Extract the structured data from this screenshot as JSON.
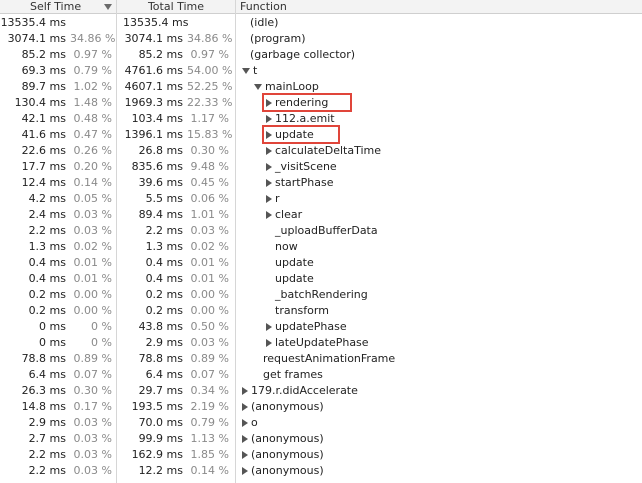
{
  "columns": {
    "self_time": "Self Time",
    "total_time": "Total Time",
    "function": "Function"
  },
  "rows": [
    {
      "self_ms": "13535.4 ms",
      "self_pct": "",
      "total_ms": "13535.4 ms",
      "total_pct": "",
      "name": "(idle)",
      "depth": 0,
      "toggle": "none"
    },
    {
      "self_ms": "3074.1 ms",
      "self_pct": "34.86 %",
      "total_ms": "3074.1 ms",
      "total_pct": "34.86 %",
      "name": "(program)",
      "depth": 0,
      "toggle": "none"
    },
    {
      "self_ms": "85.2 ms",
      "self_pct": "0.97 %",
      "total_ms": "85.2 ms",
      "total_pct": "0.97 %",
      "name": "(garbage collector)",
      "depth": 0,
      "toggle": "none"
    },
    {
      "self_ms": "69.3 ms",
      "self_pct": "0.79 %",
      "total_ms": "4761.6 ms",
      "total_pct": "54.00 %",
      "name": "t",
      "depth": 0,
      "toggle": "expanded"
    },
    {
      "self_ms": "89.7 ms",
      "self_pct": "1.02 %",
      "total_ms": "4607.1 ms",
      "total_pct": "52.25 %",
      "name": "mainLoop",
      "depth": 1,
      "toggle": "expanded"
    },
    {
      "self_ms": "130.4 ms",
      "self_pct": "1.48 %",
      "total_ms": "1969.3 ms",
      "total_pct": "22.33 %",
      "name": "rendering",
      "depth": 2,
      "toggle": "collapsed"
    },
    {
      "self_ms": "42.1 ms",
      "self_pct": "0.48 %",
      "total_ms": "103.4 ms",
      "total_pct": "1.17 %",
      "name": "112.a.emit",
      "depth": 2,
      "toggle": "collapsed"
    },
    {
      "self_ms": "41.6 ms",
      "self_pct": "0.47 %",
      "total_ms": "1396.1 ms",
      "total_pct": "15.83 %",
      "name": "update",
      "depth": 2,
      "toggle": "collapsed"
    },
    {
      "self_ms": "22.6 ms",
      "self_pct": "0.26 %",
      "total_ms": "26.8 ms",
      "total_pct": "0.30 %",
      "name": "calculateDeltaTime",
      "depth": 2,
      "toggle": "collapsed"
    },
    {
      "self_ms": "17.7 ms",
      "self_pct": "0.20 %",
      "total_ms": "835.6 ms",
      "total_pct": "9.48 %",
      "name": "_visitScene",
      "depth": 2,
      "toggle": "collapsed"
    },
    {
      "self_ms": "12.4 ms",
      "self_pct": "0.14 %",
      "total_ms": "39.6 ms",
      "total_pct": "0.45 %",
      "name": "startPhase",
      "depth": 2,
      "toggle": "collapsed"
    },
    {
      "self_ms": "4.2 ms",
      "self_pct": "0.05 %",
      "total_ms": "5.5 ms",
      "total_pct": "0.06 %",
      "name": "r",
      "depth": 2,
      "toggle": "collapsed"
    },
    {
      "self_ms": "2.4 ms",
      "self_pct": "0.03 %",
      "total_ms": "89.4 ms",
      "total_pct": "1.01 %",
      "name": "clear",
      "depth": 2,
      "toggle": "collapsed"
    },
    {
      "self_ms": "2.2 ms",
      "self_pct": "0.03 %",
      "total_ms": "2.2 ms",
      "total_pct": "0.03 %",
      "name": "_uploadBufferData",
      "depth": 2,
      "toggle": "none"
    },
    {
      "self_ms": "1.3 ms",
      "self_pct": "0.02 %",
      "total_ms": "1.3 ms",
      "total_pct": "0.02 %",
      "name": "now",
      "depth": 2,
      "toggle": "none"
    },
    {
      "self_ms": "0.4 ms",
      "self_pct": "0.01 %",
      "total_ms": "0.4 ms",
      "total_pct": "0.01 %",
      "name": "update",
      "depth": 2,
      "toggle": "none"
    },
    {
      "self_ms": "0.4 ms",
      "self_pct": "0.01 %",
      "total_ms": "0.4 ms",
      "total_pct": "0.01 %",
      "name": "update",
      "depth": 2,
      "toggle": "none"
    },
    {
      "self_ms": "0.2 ms",
      "self_pct": "0.00 %",
      "total_ms": "0.2 ms",
      "total_pct": "0.00 %",
      "name": "_batchRendering",
      "depth": 2,
      "toggle": "none"
    },
    {
      "self_ms": "0.2 ms",
      "self_pct": "0.00 %",
      "total_ms": "0.2 ms",
      "total_pct": "0.00 %",
      "name": "transform",
      "depth": 2,
      "toggle": "none"
    },
    {
      "self_ms": "0 ms",
      "self_pct": "0 %",
      "total_ms": "43.8 ms",
      "total_pct": "0.50 %",
      "name": "updatePhase",
      "depth": 2,
      "toggle": "collapsed"
    },
    {
      "self_ms": "0 ms",
      "self_pct": "0 %",
      "total_ms": "2.9 ms",
      "total_pct": "0.03 %",
      "name": "lateUpdatePhase",
      "depth": 2,
      "toggle": "collapsed"
    },
    {
      "self_ms": "78.8 ms",
      "self_pct": "0.89 %",
      "total_ms": "78.8 ms",
      "total_pct": "0.89 %",
      "name": "requestAnimationFrame",
      "depth": 1,
      "toggle": "none"
    },
    {
      "self_ms": "6.4 ms",
      "self_pct": "0.07 %",
      "total_ms": "6.4 ms",
      "total_pct": "0.07 %",
      "name": "get frames",
      "depth": 1,
      "toggle": "none"
    },
    {
      "self_ms": "26.3 ms",
      "self_pct": "0.30 %",
      "total_ms": "29.7 ms",
      "total_pct": "0.34 %",
      "name": "179.r.didAccelerate",
      "depth": 0,
      "toggle": "collapsed"
    },
    {
      "self_ms": "14.8 ms",
      "self_pct": "0.17 %",
      "total_ms": "193.5 ms",
      "total_pct": "2.19 %",
      "name": "(anonymous)",
      "depth": 0,
      "toggle": "collapsed"
    },
    {
      "self_ms": "2.9 ms",
      "self_pct": "0.03 %",
      "total_ms": "70.0 ms",
      "total_pct": "0.79 %",
      "name": "o",
      "depth": 0,
      "toggle": "collapsed"
    },
    {
      "self_ms": "2.7 ms",
      "self_pct": "0.03 %",
      "total_ms": "99.9 ms",
      "total_pct": "1.13 %",
      "name": "(anonymous)",
      "depth": 0,
      "toggle": "collapsed"
    },
    {
      "self_ms": "2.2 ms",
      "self_pct": "0.03 %",
      "total_ms": "162.9 ms",
      "total_pct": "1.85 %",
      "name": "(anonymous)",
      "depth": 0,
      "toggle": "collapsed"
    },
    {
      "self_ms": "2.2 ms",
      "self_pct": "0.03 %",
      "total_ms": "12.2 ms",
      "total_pct": "0.14 %",
      "name": "(anonymous)",
      "depth": 0,
      "toggle": "collapsed"
    }
  ],
  "highlighted_rows": [
    5,
    7
  ],
  "colors": {
    "highlight": "#e0453a",
    "header_bg": "#f3f3f3",
    "percent_text": "#8a8a8a"
  }
}
